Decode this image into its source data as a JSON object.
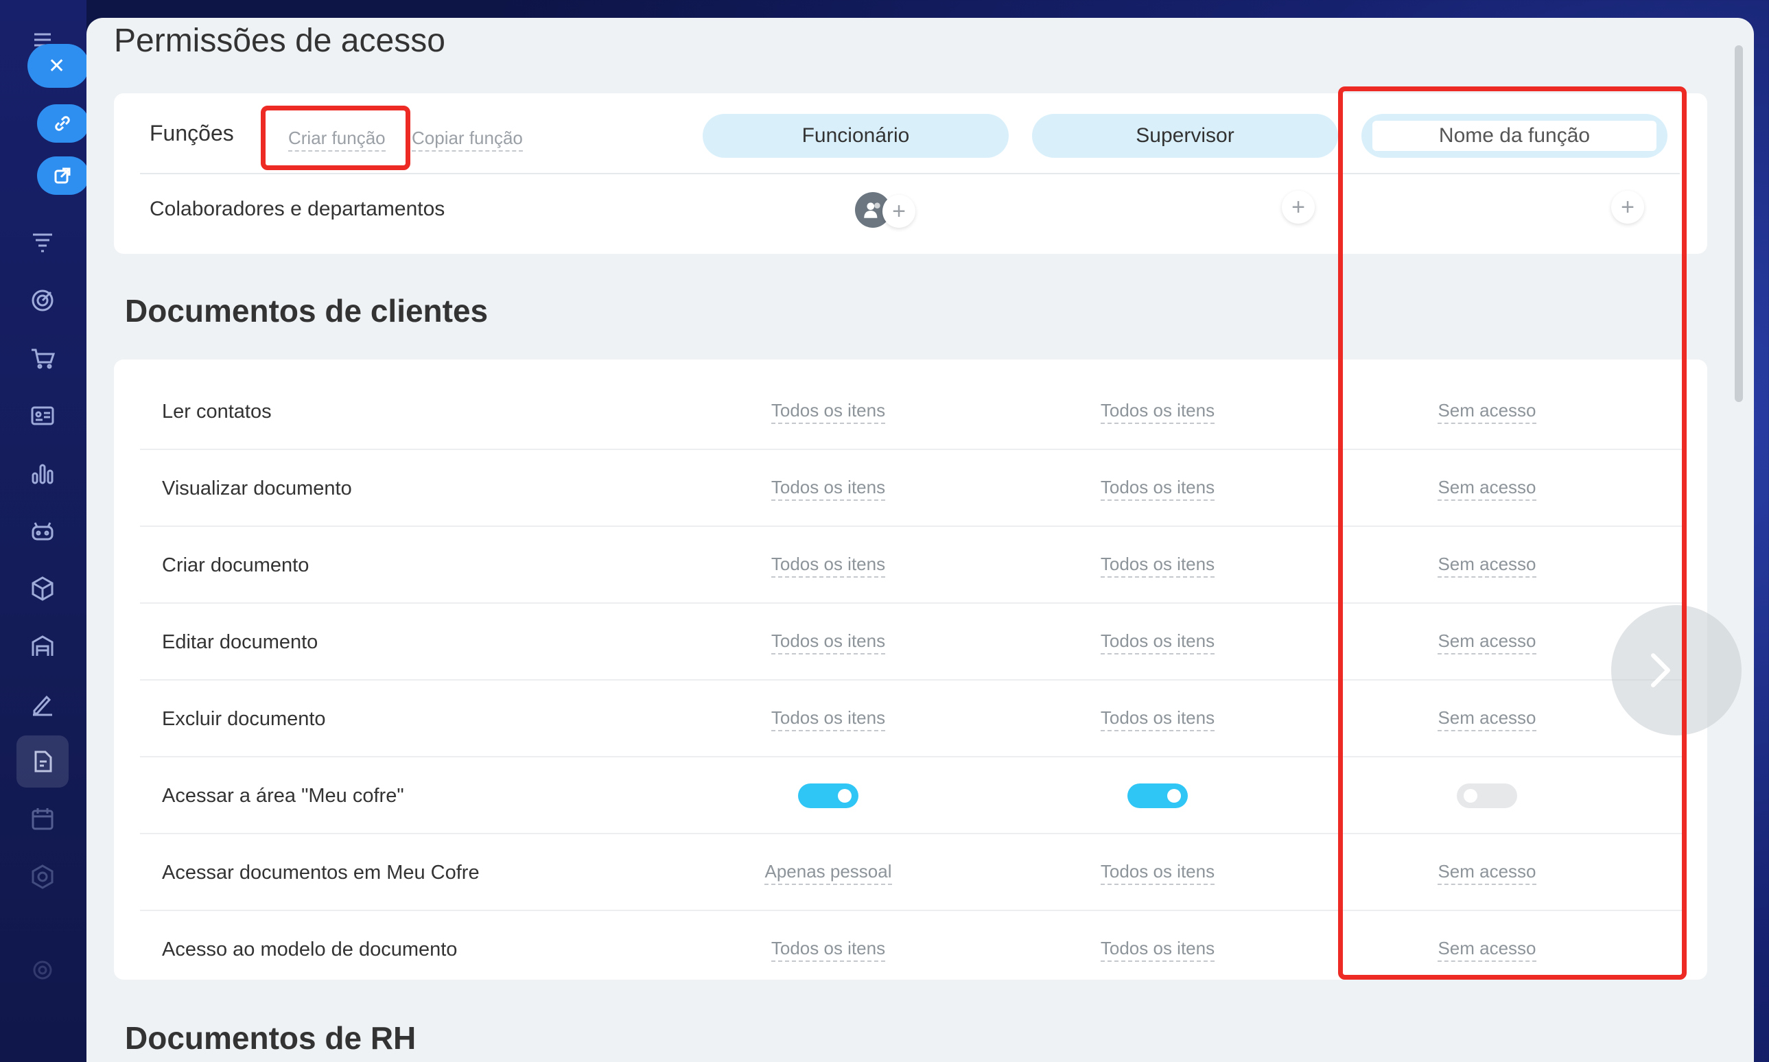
{
  "page": {
    "title": "Permissões de acesso"
  },
  "roles_card": {
    "roles_label": "Funções",
    "create_role": "Criar função",
    "copy_role": "Copiar função",
    "roles": [
      "Funcionário",
      "Supervisor"
    ],
    "new_role_placeholder": "Nome da função",
    "employees_label": "Colaboradores e departamentos",
    "add_symbol": "+"
  },
  "section_clients": {
    "title": "Documentos de clientes",
    "rows": [
      {
        "label": "Ler contatos",
        "values": [
          "Todos os itens",
          "Todos os itens",
          "Sem acesso"
        ]
      },
      {
        "label": "Visualizar documento",
        "values": [
          "Todos os itens",
          "Todos os itens",
          "Sem acesso"
        ]
      },
      {
        "label": "Criar documento",
        "values": [
          "Todos os itens",
          "Todos os itens",
          "Sem acesso"
        ]
      },
      {
        "label": "Editar documento",
        "values": [
          "Todos os itens",
          "Todos os itens",
          "Sem acesso"
        ]
      },
      {
        "label": "Excluir documento",
        "values": [
          "Todos os itens",
          "Todos os itens",
          "Sem acesso"
        ]
      },
      {
        "label": "Acessar a área \"Meu cofre\"",
        "toggles": [
          true,
          true,
          false
        ]
      },
      {
        "label": "Acessar documentos em Meu Cofre",
        "values": [
          "Apenas pessoal",
          "Todos os itens",
          "Sem acesso"
        ]
      },
      {
        "label": "Acesso ao modelo de documento",
        "values": [
          "Todos os itens",
          "Todos os itens",
          "Sem acesso"
        ]
      }
    ]
  },
  "section_hr": {
    "title": "Documentos de RH"
  },
  "colors": {
    "accent": "#2fc6f6",
    "role_pill": "#d9f0fb",
    "highlight": "#ee2a24",
    "sidebar": "#17206a"
  },
  "icons": {
    "close": "close-icon",
    "link": "link-icon",
    "external": "external-link-icon"
  }
}
